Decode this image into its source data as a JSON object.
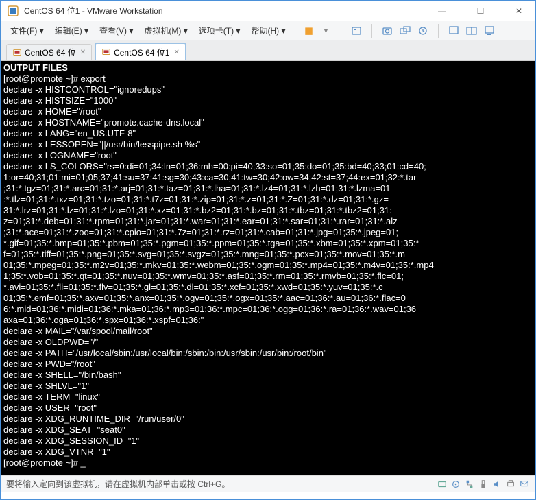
{
  "window": {
    "title": "CentOS 64 位1 - VMware Workstation"
  },
  "menus": {
    "file": "文件(F)",
    "edit": "编辑(E)",
    "view": "查看(V)",
    "vm": "虚拟机(M)",
    "tabs": "选项卡(T)",
    "help": "帮助(H)"
  },
  "tabs": [
    {
      "label": "CentOS 64 位"
    },
    {
      "label": "CentOS 64 位1"
    }
  ],
  "active_tab": 1,
  "terminal": {
    "lines": [
      "OUTPUT FILES",
      "[root@promote ~]# export",
      "declare -x HISTCONTROL=\"ignoredups\"",
      "declare -x HISTSIZE=\"1000\"",
      "declare -x HOME=\"/root\"",
      "declare -x HOSTNAME=\"promote.cache-dns.local\"",
      "declare -x LANG=\"en_US.UTF-8\"",
      "declare -x LESSOPEN=\"||/usr/bin/lesspipe.sh %s\"",
      "declare -x LOGNAME=\"root\"",
      "declare -x LS_COLORS=\"rs=0:di=01;34:ln=01;36:mh=00:pi=40;33:so=01;35:do=01;35:bd=40;33;01:cd=40;",
      "1:or=40;31;01:mi=01;05;37;41:su=37;41:sg=30;43:ca=30;41:tw=30;42:ow=34;42:st=37;44:ex=01;32:*.tar",
      ";31:*.tgz=01;31:*.arc=01;31:*.arj=01;31:*.taz=01;31:*.lha=01;31:*.lz4=01;31:*.lzh=01;31:*.lzma=01",
      ":*.tlz=01;31:*.txz=01;31:*.tzo=01;31:*.t7z=01;31:*.zip=01;31:*.z=01;31:*.Z=01;31:*.dz=01;31:*.gz=",
      "31:*.lrz=01;31:*.lz=01;31:*.lzo=01;31:*.xz=01;31:*.bz2=01;31:*.bz=01;31:*.tbz=01;31:*.tbz2=01;31:",
      "z=01;31:*.deb=01;31:*.rpm=01;31:*.jar=01;31:*.war=01;31:*.ear=01;31:*.sar=01;31:*.rar=01;31:*.alz",
      ";31:*.ace=01;31:*.zoo=01;31:*.cpio=01;31:*.7z=01;31:*.rz=01;31:*.cab=01;31:*.jpg=01;35:*.jpeg=01;",
      "*.gif=01;35:*.bmp=01;35:*.pbm=01;35:*.pgm=01;35:*.ppm=01;35:*.tga=01;35:*.xbm=01;35:*.xpm=01;35:*",
      "f=01;35:*.tiff=01;35:*.png=01;35:*.svg=01;35:*.svgz=01;35:*.mng=01;35:*.pcx=01;35:*.mov=01;35:*.m",
      "01;35:*.mpeg=01;35:*.m2v=01;35:*.mkv=01;35:*.webm=01;35:*.ogm=01;35:*.mp4=01;35:*.m4v=01;35:*.mp4",
      "1;35:*.vob=01;35:*.qt=01;35:*.nuv=01;35:*.wmv=01;35:*.asf=01;35:*.rm=01;35:*.rmvb=01;35:*.flc=01;",
      "*.avi=01;35:*.fli=01;35:*.flv=01;35:*.gl=01;35:*.dl=01;35:*.xcf=01;35:*.xwd=01;35:*.yuv=01;35:*.c",
      "01;35:*.emf=01;35:*.axv=01;35:*.anx=01;35:*.ogv=01;35:*.ogx=01;35:*.aac=01;36:*.au=01;36:*.flac=0",
      "6:*.mid=01;36:*.midi=01;36:*.mka=01;36:*.mp3=01;36:*.mpc=01;36:*.ogg=01;36:*.ra=01;36:*.wav=01;36",
      "axa=01;36:*.oga=01;36:*.spx=01;36:*.xspf=01;36:\"",
      "declare -x MAIL=\"/var/spool/mail/root\"",
      "declare -x OLDPWD=\"/\"",
      "declare -x PATH=\"/usr/local/sbin:/usr/local/bin:/sbin:/bin:/usr/sbin:/usr/bin:/root/bin\"",
      "declare -x PWD=\"/root\"",
      "declare -x SHELL=\"/bin/bash\"",
      "declare -x SHLVL=\"1\"",
      "declare -x TERM=\"linux\"",
      "declare -x USER=\"root\"",
      "declare -x XDG_RUNTIME_DIR=\"/run/user/0\"",
      "declare -x XDG_SEAT=\"seat0\"",
      "declare -x XDG_SESSION_ID=\"1\"",
      "declare -x XDG_VTNR=\"1\"",
      "[root@promote ~]# _"
    ]
  },
  "statusbar": {
    "hint": "要将输入定向到该虚拟机，请在虚拟机内部单击或按 Ctrl+G。"
  }
}
